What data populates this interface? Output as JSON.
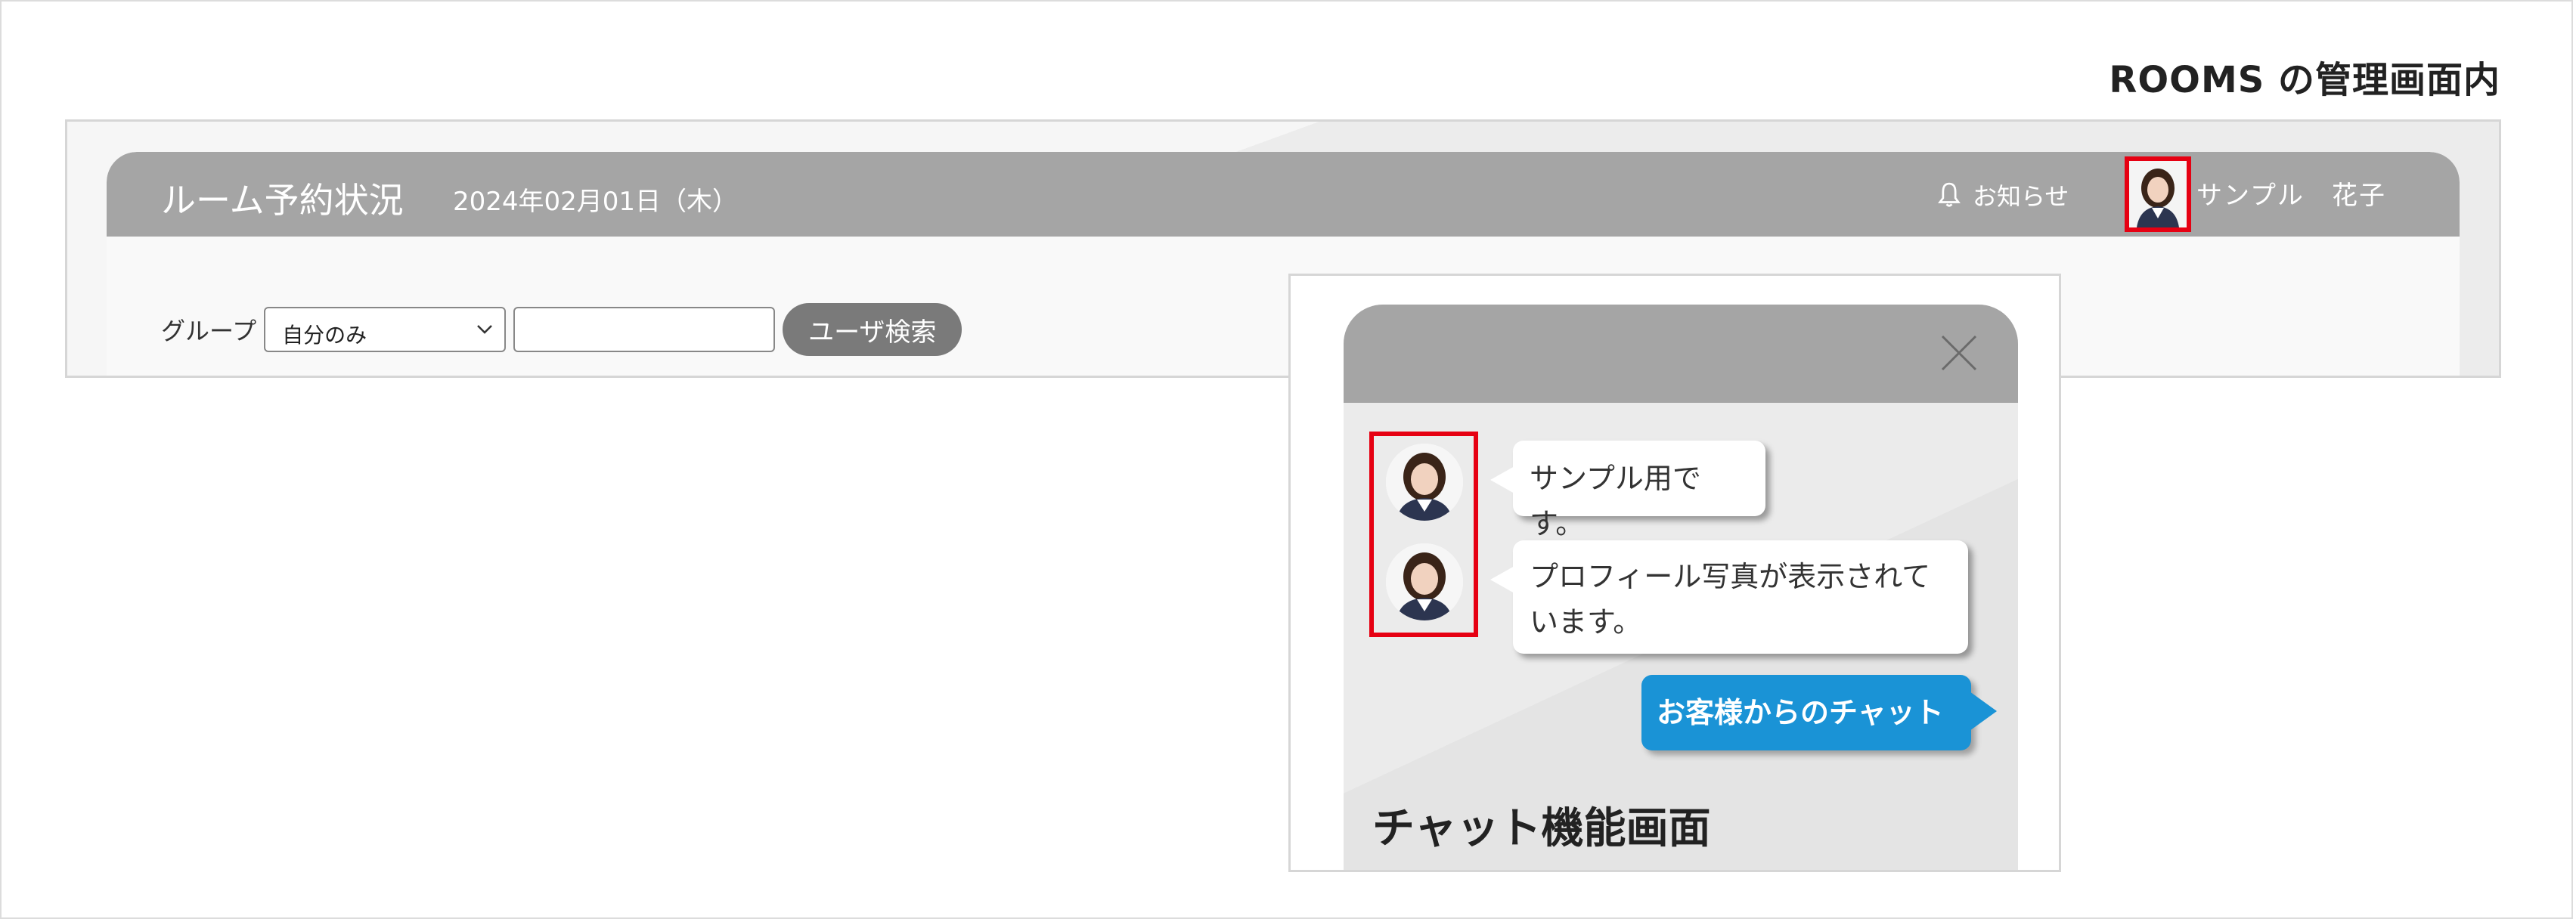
{
  "caption": "ROOMS の管理画面内",
  "admin": {
    "title": "ルーム予約状況",
    "date": "2024年02月01日（木）",
    "notice_label": "お知らせ",
    "user_name": "サンプル　花子",
    "group_label": "グループ",
    "group_selected": "自分のみ",
    "search_button": "ユーザ検索",
    "search_value": ""
  },
  "chat": {
    "messages_in": [
      "サンプル用です。",
      "プロフィール写真が表示されて\nいます。"
    ],
    "message_out": "お客様からのチャット",
    "caption": "チャット機能画面"
  },
  "colors": {
    "header_gray": "#a5a5a5",
    "highlight_red": "#e60012",
    "outgoing_blue": "#1a93d6",
    "button_gray": "#7a7a7a"
  },
  "icons": [
    "bell-icon",
    "chevron-down-icon",
    "close-icon",
    "avatar"
  ]
}
